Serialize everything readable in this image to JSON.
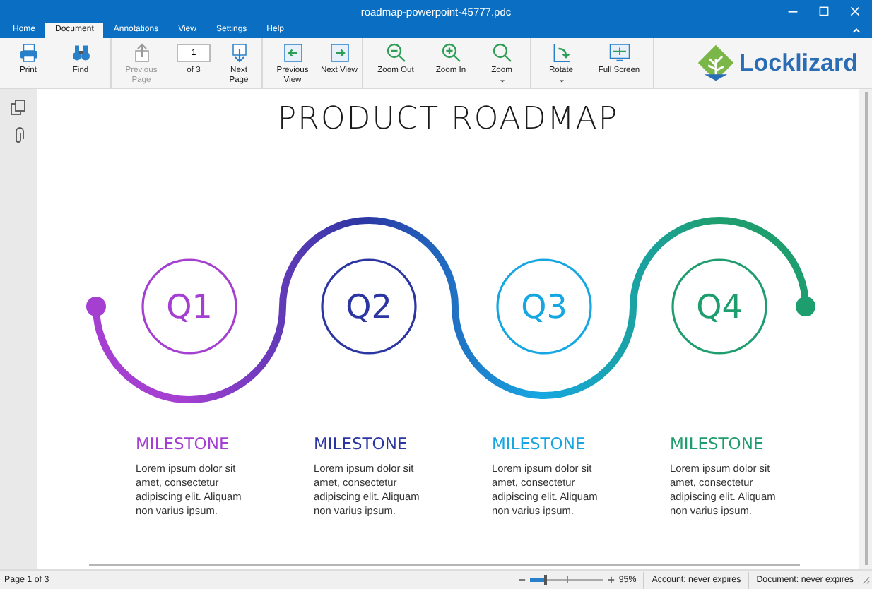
{
  "window": {
    "title": "roadmap-powerpoint-45777.pdc"
  },
  "tabs": [
    {
      "label": "Home",
      "selected": false
    },
    {
      "label": "Document",
      "selected": true
    },
    {
      "label": "Annotations",
      "selected": false
    },
    {
      "label": "View",
      "selected": false
    },
    {
      "label": "Settings",
      "selected": false
    },
    {
      "label": "Help",
      "selected": false
    }
  ],
  "toolbar": {
    "groups": [
      {
        "items": [
          {
            "kind": "button",
            "label": "Print",
            "disabled": false,
            "dropdown": false
          },
          {
            "kind": "button",
            "label": "Find",
            "disabled": false,
            "dropdown": false
          }
        ]
      },
      {
        "items": [
          {
            "kind": "button",
            "label": "Previous Page",
            "disabled": true,
            "dropdown": false
          },
          {
            "kind": "page_field",
            "value": "1",
            "label": "of 3"
          },
          {
            "kind": "button",
            "label": "Next Page",
            "disabled": false,
            "dropdown": false
          }
        ]
      },
      {
        "items": [
          {
            "kind": "button",
            "label": "Previous View",
            "disabled": false,
            "dropdown": false
          },
          {
            "kind": "button",
            "label": "Next View",
            "disabled": false,
            "dropdown": false
          }
        ]
      },
      {
        "items": [
          {
            "kind": "button",
            "label": "Zoom Out",
            "disabled": false,
            "dropdown": false
          },
          {
            "kind": "button",
            "label": "Zoom In",
            "disabled": false,
            "dropdown": false
          },
          {
            "kind": "button",
            "label": "Zoom",
            "disabled": false,
            "dropdown": true
          }
        ]
      },
      {
        "items": [
          {
            "kind": "button",
            "label": "Rotate",
            "disabled": false,
            "dropdown": true
          },
          {
            "kind": "button",
            "label": "Full Screen",
            "disabled": false,
            "dropdown": false
          }
        ]
      }
    ]
  },
  "logo": {
    "text": "Locklizard"
  },
  "document": {
    "title": "PRODUCT ROADMAP",
    "stages": [
      {
        "quarter": "Q1",
        "heading": "MILESTONE",
        "text": "Lorem ipsum dolor sit amet, consectetur adipiscing elit. Aliquam non varius ipsum.",
        "color": "#a43fd1"
      },
      {
        "quarter": "Q2",
        "heading": "MILESTONE",
        "text": "Lorem ipsum dolor sit amet, consectetur adipiscing elit. Aliquam non varius ipsum.",
        "color": "#2b36a3"
      },
      {
        "quarter": "Q3",
        "heading": "MILESTONE",
        "text": "Lorem ipsum dolor sit amet, consectetur adipiscing elit. Aliquam non varius ipsum.",
        "color": "#16a7e2"
      },
      {
        "quarter": "Q4",
        "heading": "MILESTONE",
        "text": "Lorem ipsum dolor sit amet, consectetur adipiscing elit. Aliquam non varius ipsum.",
        "color": "#1e9e6e"
      }
    ]
  },
  "status_bar": {
    "page": "Page 1 of 3",
    "zoom": {
      "level": 0.2,
      "reading": "95%"
    },
    "account": "Account: never expires",
    "document": "Document: never expires"
  }
}
